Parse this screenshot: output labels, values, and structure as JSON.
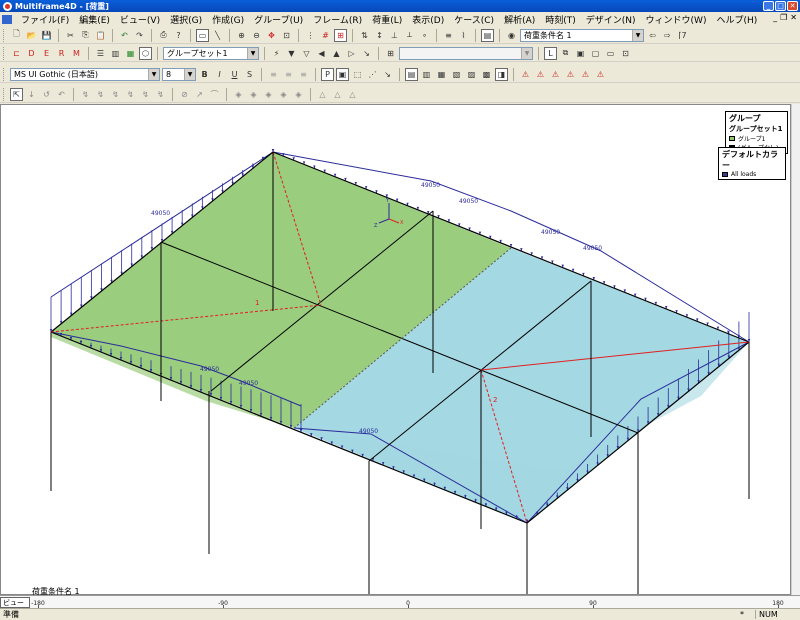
{
  "window": {
    "title": "Multiframe4D - [荷重]"
  },
  "menu": [
    "ファイル(F)",
    "編集(E)",
    "ビュー(V)",
    "選択(G)",
    "作成(G)",
    "グループ(U)",
    "フレーム(R)",
    "荷重(L)",
    "表示(D)",
    "ケース(C)",
    "解析(A)",
    "時刻(T)",
    "デザイン(N)",
    "ウィンドウ(W)",
    "ヘルプ(H)"
  ],
  "toolbar2": {
    "group_set": "グループセット1"
  },
  "toolbar1": {
    "load_case": "荷重条件名 1"
  },
  "toolbar3": {
    "font_name": "MS UI Gothic (日本語)",
    "font_size": "8",
    "bold": "B",
    "italic": "I",
    "underline": "U",
    "strike": "S"
  },
  "legend_group": {
    "title": "グループ",
    "subtitle": "グループセット1",
    "items": [
      {
        "label": "グループ1",
        "color": "#8dc86a"
      },
      {
        "label": "(グループなし)",
        "color": "#000000"
      }
    ]
  },
  "legend_color": {
    "title": "デフォルトカラー",
    "items": [
      {
        "label": "All loads",
        "color": "#3a3a8a"
      }
    ]
  },
  "model": {
    "load_labels": [
      "49050",
      "49050",
      "49050",
      "49050",
      "49050",
      "49050",
      "49050"
    ],
    "plate_labels": [
      "1",
      "2"
    ],
    "colors": {
      "plate1": "#9acd7e",
      "plate2": "#a4d8e2",
      "load": "#2b2b9a",
      "member": "#000000",
      "diag": "#e02020"
    }
  },
  "canvas_label": "荷重条件名 1",
  "ruler": {
    "labels": [
      "-180",
      "-90",
      "0",
      "90",
      "180"
    ]
  },
  "view_tab": "ビュー",
  "status": {
    "text": "準備",
    "star": "*",
    "num": "NUM"
  }
}
